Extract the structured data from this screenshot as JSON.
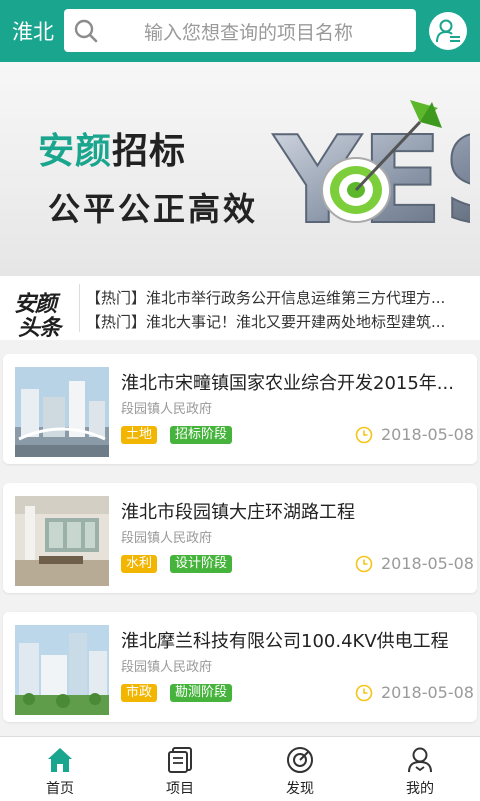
{
  "header": {
    "city": "淮北",
    "search_placeholder": "输入您想查询的项目名称"
  },
  "banner": {
    "title_accent": "安颜",
    "title_rest": "招标",
    "subtitle": "公平公正高效",
    "art_text": "YES",
    "slide_count": 3,
    "active_slide": 2
  },
  "headlines": {
    "logo_line1": "安颜",
    "logo_line2": "头条",
    "items": [
      "【热门】淮北市举行政务公开信息运维第三方代理方...",
      "【热门】淮北大事记！淮北又要开建两处地标型建筑..."
    ]
  },
  "projects": [
    {
      "title": "淮北市宋疃镇国家农业综合开发2015年...",
      "org": "段园镇人民政府",
      "tag1": "土地",
      "tag2": "招标阶段",
      "date": "2018-05-08"
    },
    {
      "title": "淮北市段园镇大庄环湖路工程",
      "org": "段园镇人民政府",
      "tag1": "水利",
      "tag2": "设计阶段",
      "date": "2018-05-08"
    },
    {
      "title": "淮北摩兰科技有限公司100.4KV供电工程",
      "org": "段园镇人民政府",
      "tag1": "市政",
      "tag2": "勘测阶段",
      "date": "2018-05-08"
    }
  ],
  "tabbar": {
    "items": [
      {
        "label": "首页",
        "icon": "home-icon",
        "active": true
      },
      {
        "label": "项目",
        "icon": "project-icon",
        "active": false
      },
      {
        "label": "发现",
        "icon": "discover-icon",
        "active": false
      },
      {
        "label": "我的",
        "icon": "profile-icon",
        "active": false
      }
    ]
  },
  "colors": {
    "brand": "#1aa58e",
    "tag_yellow": "#f2b500",
    "tag_green": "#46b43c",
    "dot_active": "#f5c518"
  }
}
